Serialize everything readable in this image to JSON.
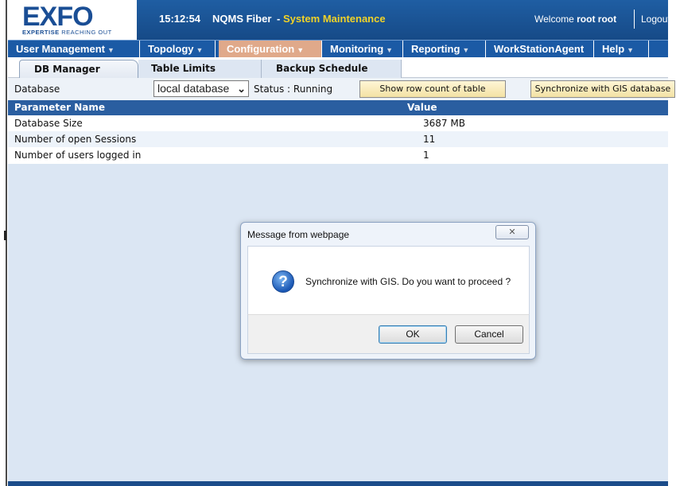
{
  "header": {
    "logo_text": "EXFO",
    "logo_tag_strong": "EXPERTISE",
    "logo_tag_rest": "REACHING OUT",
    "time": "15:12:54",
    "app_name": "NQMS Fiber",
    "mode_separator": "-",
    "mode": "System Maintenance",
    "welcome_prefix": "Welcome",
    "user": "root root",
    "logout": "Logout"
  },
  "menu": [
    {
      "label": "User Management",
      "active": false
    },
    {
      "label": "Topology",
      "active": false
    },
    {
      "label": "Configuration",
      "active": true
    },
    {
      "label": "Monitoring",
      "active": false
    },
    {
      "label": "Reporting",
      "active": false
    },
    {
      "label": "WorkStationAgent",
      "active": false
    },
    {
      "label": "Help",
      "active": false
    }
  ],
  "tabs": [
    {
      "label": "DB Manager",
      "active": true
    },
    {
      "label": "Table Limits",
      "active": false
    },
    {
      "label": "Backup Schedule",
      "active": false
    }
  ],
  "toolbar": {
    "database_label": "Database",
    "database_selected": "local database",
    "status_text": "Status : Running",
    "row_count_button": "Show row count of table",
    "sync_gis_button": "Synchronize with GIS database"
  },
  "table": {
    "headers": [
      "Parameter Name",
      "Value"
    ],
    "rows": [
      [
        "Database Size",
        "3687 MB"
      ],
      [
        "Number of open Sessions",
        "11"
      ],
      [
        "Number of users logged in",
        "1"
      ]
    ]
  },
  "dialog": {
    "title": "Message from webpage",
    "message": "Synchronize with GIS. Do you want to proceed ?",
    "ok_label": "OK",
    "cancel_label": "Cancel",
    "icon": "question-icon"
  },
  "colors": {
    "header_blue": "#1f5ea3",
    "mode_yellow": "#f0d228",
    "active_menu": "#e0a98a",
    "table_header": "#2a5ea0",
    "content_bg": "#dbe6f3"
  }
}
